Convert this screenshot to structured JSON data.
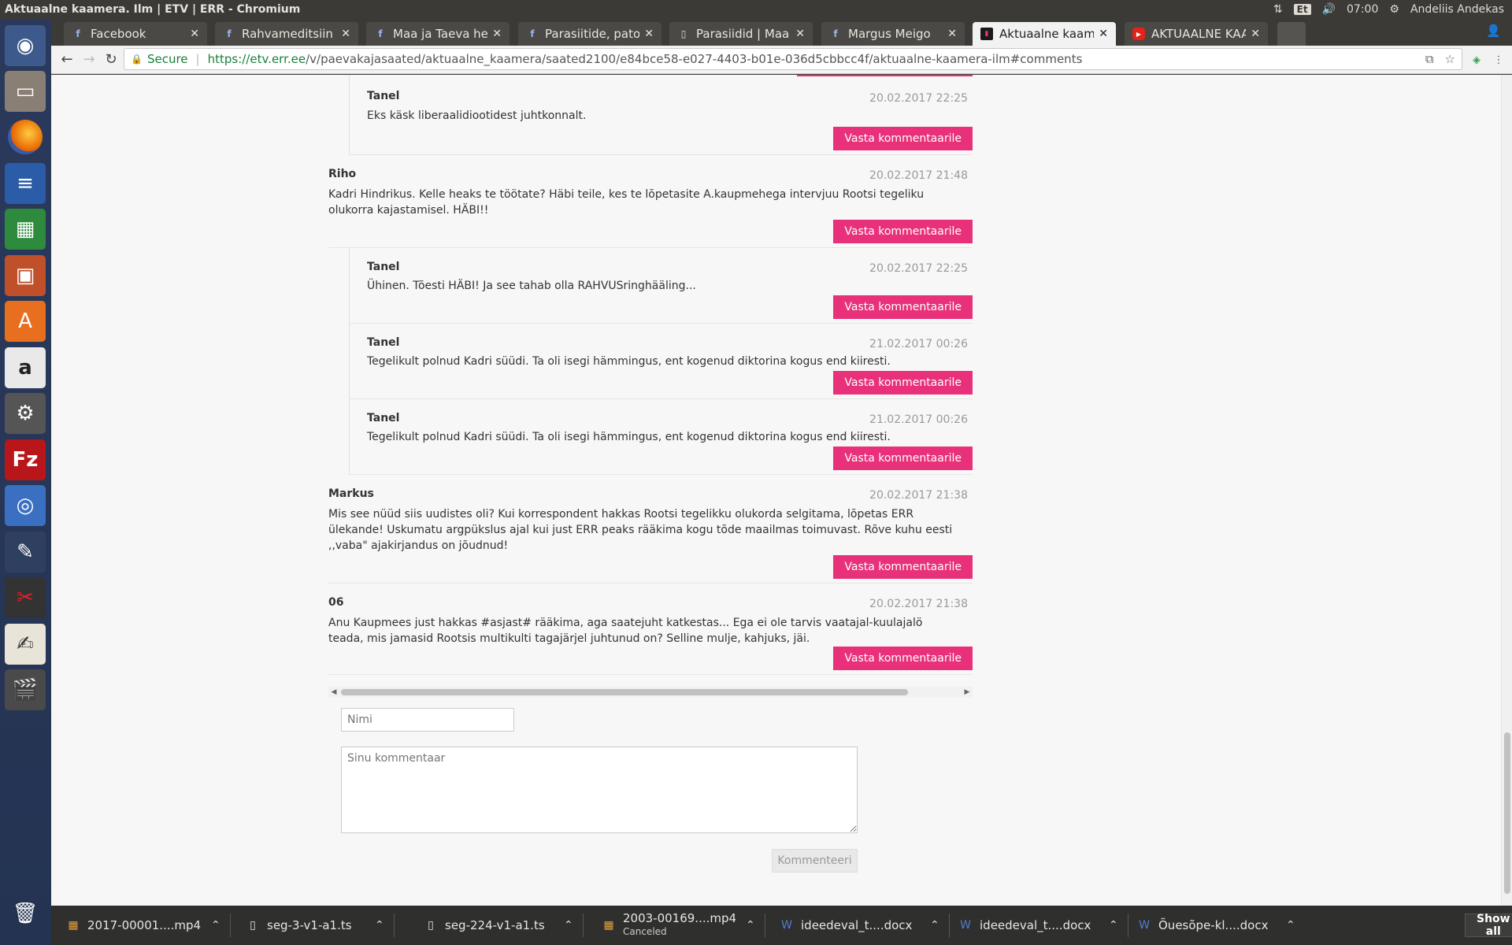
{
  "system": {
    "window_title": "Aktuaalne kaamera. Ilm | ETV | ERR - Chromium",
    "keyboard_layout": "Et",
    "clock": "07:00",
    "user": "Andeliis Andekas"
  },
  "launcher": {
    "items": [
      "ubuntu-dash-icon",
      "files-icon",
      "firefox-icon",
      "writer-icon",
      "calc-icon",
      "impress-icon",
      "software-center-icon",
      "amazon-icon",
      "system-settings-icon",
      "filezilla-icon",
      "chromium-icon",
      "paint-icon",
      "red-app-icon",
      "text-editor-icon",
      "video-editor-icon",
      "trash-icon"
    ]
  },
  "tabs": [
    {
      "label": "Facebook",
      "icon": "f",
      "active": false
    },
    {
      "label": "Rahvameditsiin ja t",
      "icon": "f",
      "active": false
    },
    {
      "label": "Maa ja Taeva heaolu",
      "icon": "f",
      "active": false
    },
    {
      "label": "Parasiitide, patoge",
      "icon": "f",
      "active": false
    },
    {
      "label": "Parasiidid | Maa ja T",
      "icon": "page",
      "active": false
    },
    {
      "label": "Margus Meigo",
      "icon": "f",
      "active": false
    },
    {
      "label": "Aktuaalne kaamera",
      "icon": "err",
      "active": true
    },
    {
      "label": "AKTUAALNE KAAM",
      "icon": "yt",
      "active": false
    }
  ],
  "addressbar": {
    "secure_label": "Secure",
    "url_host": "https://etv.err.ee",
    "url_rest": "/v/paevakajasaated/aktuaalne_kaamera/saated2100/e84bce58-e027-4403-b01e-036d5cbbcc4f/aktuaalne-kaamera-ilm#comments"
  },
  "reply_label": "Vasta kommentaarile",
  "comments": [
    {
      "author": "Tanel",
      "date": "20.02.2017 22:25",
      "text": "Eks käsk liberaalidiootidest juhtkonnalt.",
      "reply": true
    },
    {
      "author": "Riho",
      "date": "20.02.2017 21:48",
      "text": "Kadri Hindrikus. Kelle heaks te töötate? Häbi teile, kes te lõpetasite A.kaupmehega intervjuu Rootsi tegeliku olukorra kajastamisel. HÄBI!!",
      "reply": false
    },
    {
      "author": "Tanel",
      "date": "20.02.2017 22:25",
      "text": "Ühinen. Tõesti HÄBI! Ja see tahab olla RAHVUSringhääling...",
      "reply": true
    },
    {
      "author": "Tanel",
      "date": "21.02.2017 00:26",
      "text": "Tegelikult polnud Kadri süüdi. Ta oli isegi hämmingus, ent kogenud diktorina kogus end kiiresti.",
      "reply": true
    },
    {
      "author": "Tanel",
      "date": "21.02.2017 00:26",
      "text": "Tegelikult polnud Kadri süüdi. Ta oli isegi hämmingus, ent kogenud diktorina kogus end kiiresti.",
      "reply": true
    },
    {
      "author": "Markus",
      "date": "20.02.2017 21:38",
      "text": "Mis see nüüd siis uudistes oli? Kui korrespondent hakkas Rootsi tegelikku olukorda selgitama, lõpetas ERR ülekande! Uskumatu argpükslus ajal kui just ERR peaks rääkima kogu tõde maailmas toimuvast. Rõve kuhu eesti ,,vaba\" ajakirjandus on jõudnud!",
      "reply": false
    },
    {
      "author": "06",
      "date": "20.02.2017 21:38",
      "text": "Anu Kaupmees just hakkas #asjast# rääkima, aga saatejuht katkestas... Ega ei ole tarvis vaatajal-kuulajalö teada, mis jamasid Rootsis multikulti tagajärjel juhtunud on? Selline mulje, kahjuks, jäi.",
      "reply": false
    }
  ],
  "form": {
    "name_placeholder": "Nimi",
    "comment_placeholder": "Sinu kommentaar",
    "submit_label": "Kommenteeri"
  },
  "downloads": [
    {
      "name": "2017-00001....mp4",
      "status": "",
      "icon": "video-file-icon"
    },
    {
      "name": "seg-3-v1-a1.ts",
      "status": "",
      "icon": "file-icon"
    },
    {
      "name": "seg-224-v1-a1.ts",
      "status": "",
      "icon": "file-icon"
    },
    {
      "name": "2003-00169....mp4",
      "status": "Canceled",
      "icon": "video-file-icon"
    },
    {
      "name": "ideedeval_t....docx",
      "status": "",
      "icon": "word-file-icon"
    },
    {
      "name": "ideedeval_t....docx",
      "status": "",
      "icon": "word-file-icon"
    },
    {
      "name": "Õuesõpe-kl....docx",
      "status": "",
      "icon": "word-file-icon"
    }
  ],
  "show_all_label": "Show all"
}
